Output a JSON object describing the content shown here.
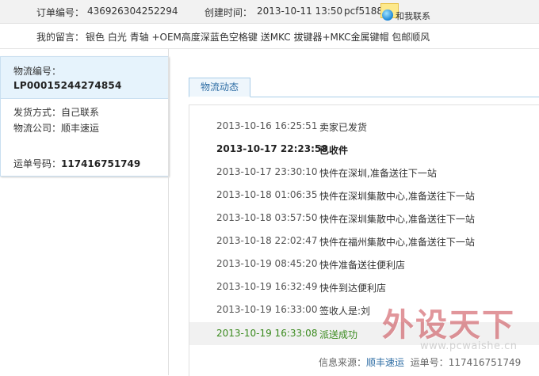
{
  "order": {
    "number_label": "订单编号：",
    "number_value": "436926304252294",
    "created_label": "创建时间：",
    "created_value": "2013-10-11 13:50",
    "seller": "pcf5188",
    "chat_label": "和我联系"
  },
  "message": {
    "label": "我的留言：",
    "text": "银色 白光 青轴 +OEM高度深蓝色空格键 送MKC 拔键器+MKC金属键帽 包邮顺风"
  },
  "logistics": {
    "number_label": "物流编号：",
    "number_value": "LP00015244274854",
    "ship_method_label": "发货方式：",
    "ship_method_value": "自己联系",
    "company_label": "物流公司：",
    "company_value": "顺丰速运",
    "waybill_label": "运单号码：",
    "waybill_value": "117416751749"
  },
  "tabs": [
    {
      "label": "物流动态"
    }
  ],
  "events": [
    {
      "time": "2013-10-16 16:25:51",
      "desc": "卖家已发货"
    },
    {
      "time": "2013-10-17 22:23:58",
      "desc": "已收件"
    },
    {
      "time": "2013-10-17 23:30:10",
      "desc": "快件在深圳,准备送往下一站"
    },
    {
      "time": "2013-10-18 01:06:35",
      "desc": "快件在深圳集散中心,准备送往下一站"
    },
    {
      "time": "2013-10-18 03:57:50",
      "desc": "快件在深圳集散中心,准备送往下一站"
    },
    {
      "time": "2013-10-18 22:02:47",
      "desc": "快件在福州集散中心,准备送往下一站"
    },
    {
      "time": "2013-10-19 08:45:20",
      "desc": "快件准备送往便利店"
    },
    {
      "time": "2013-10-19 16:32:49",
      "desc": "快件到达便利店"
    },
    {
      "time": "2013-10-19 16:33:00",
      "desc": "签收人是:刘"
    },
    {
      "time": "2013-10-19 16:33:08",
      "desc": "派送成功"
    }
  ],
  "source": {
    "label": "信息来源：",
    "company": "顺丰速运",
    "waybill_label": "运单号：",
    "waybill_value": "117416751749"
  },
  "watermark": {
    "main": "外设天下",
    "sub": "www.pcwaishe.cn"
  },
  "colors": {
    "link": "#2e6da4",
    "success": "#3a8a1e",
    "panel_bg": "#e6f3fc",
    "watermark": "#c9414b"
  }
}
